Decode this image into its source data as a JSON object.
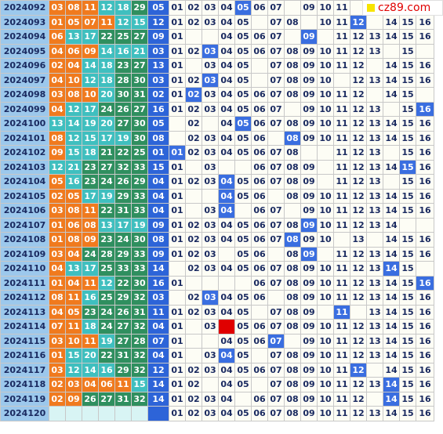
{
  "logo_text": "cz89.com",
  "rows": [
    {
      "period": "2024092",
      "balls": [
        "03",
        "08",
        "11",
        "12",
        "18",
        "29"
      ],
      "styles": [
        "r",
        "r",
        "r",
        "t",
        "t",
        "g"
      ],
      "blue": "05",
      "grid": [
        "01",
        "02",
        "03",
        "04",
        "05",
        "06",
        "07",
        "",
        "09",
        "10",
        "11",
        "",
        "",
        "",
        "",
        ""
      ],
      "hits": [
        5
      ],
      "redhit": []
    },
    {
      "period": "2024093",
      "balls": [
        "01",
        "05",
        "07",
        "11",
        "12",
        "15"
      ],
      "styles": [
        "r",
        "r",
        "r",
        "r",
        "t",
        "t"
      ],
      "blue": "12",
      "grid": [
        "01",
        "02",
        "03",
        "04",
        "05",
        "",
        "07",
        "08",
        "",
        "10",
        "11",
        "12",
        "",
        "14",
        "15",
        "16"
      ],
      "hits": [
        12
      ],
      "redhit": []
    },
    {
      "period": "2024094",
      "balls": [
        "06",
        "13",
        "17",
        "22",
        "25",
        "27"
      ],
      "styles": [
        "r",
        "t",
        "t",
        "g",
        "g",
        "g"
      ],
      "blue": "09",
      "grid": [
        "01",
        "",
        "",
        "04",
        "05",
        "06",
        "07",
        "",
        "09",
        "",
        "11",
        "12",
        "13",
        "14",
        "15",
        "16"
      ],
      "hits": [
        9
      ],
      "redhit": []
    },
    {
      "period": "2024095",
      "balls": [
        "04",
        "06",
        "09",
        "14",
        "16",
        "21"
      ],
      "styles": [
        "r",
        "r",
        "r",
        "t",
        "t",
        "t"
      ],
      "blue": "03",
      "grid": [
        "01",
        "02",
        "03",
        "04",
        "05",
        "06",
        "07",
        "08",
        "09",
        "10",
        "11",
        "12",
        "13",
        "",
        "15",
        ""
      ],
      "hits": [
        3
      ],
      "redhit": []
    },
    {
      "period": "2024096",
      "balls": [
        "02",
        "04",
        "14",
        "18",
        "23",
        "27"
      ],
      "styles": [
        "r",
        "r",
        "t",
        "t",
        "g",
        "g"
      ],
      "blue": "13",
      "grid": [
        "01",
        "",
        "03",
        "04",
        "05",
        "",
        "07",
        "08",
        "09",
        "10",
        "11",
        "12",
        "",
        "14",
        "15",
        "16"
      ],
      "hits": [],
      "redhit": []
    },
    {
      "period": "2024097",
      "balls": [
        "04",
        "10",
        "12",
        "18",
        "28",
        "30"
      ],
      "styles": [
        "r",
        "r",
        "t",
        "t",
        "g",
        "g"
      ],
      "blue": "03",
      "grid": [
        "01",
        "02",
        "03",
        "04",
        "05",
        "",
        "07",
        "08",
        "09",
        "10",
        "",
        "12",
        "13",
        "14",
        "15",
        "16"
      ],
      "hits": [
        3
      ],
      "redhit": []
    },
    {
      "period": "2024098",
      "balls": [
        "03",
        "08",
        "10",
        "20",
        "30",
        "31"
      ],
      "styles": [
        "r",
        "r",
        "r",
        "t",
        "g",
        "g"
      ],
      "blue": "02",
      "grid": [
        "01",
        "02",
        "03",
        "04",
        "05",
        "06",
        "07",
        "08",
        "09",
        "10",
        "11",
        "12",
        "",
        "14",
        "15",
        ""
      ],
      "hits": [
        2
      ],
      "redhit": []
    },
    {
      "period": "2024099",
      "balls": [
        "04",
        "12",
        "17",
        "24",
        "26",
        "27"
      ],
      "styles": [
        "r",
        "t",
        "t",
        "g",
        "g",
        "g"
      ],
      "blue": "16",
      "grid": [
        "01",
        "02",
        "03",
        "04",
        "05",
        "06",
        "07",
        "",
        "09",
        "10",
        "11",
        "12",
        "13",
        "",
        "15",
        "16"
      ],
      "hits": [
        16
      ],
      "redhit": []
    },
    {
      "period": "2024100",
      "balls": [
        "13",
        "14",
        "19",
        "20",
        "27",
        "30"
      ],
      "styles": [
        "t",
        "t",
        "t",
        "t",
        "g",
        "g"
      ],
      "blue": "05",
      "grid": [
        "",
        "02",
        "",
        "04",
        "05",
        "06",
        "07",
        "08",
        "09",
        "10",
        "11",
        "12",
        "13",
        "14",
        "15",
        "16"
      ],
      "hits": [
        5
      ],
      "redhit": []
    },
    {
      "period": "2024101",
      "balls": [
        "08",
        "12",
        "15",
        "17",
        "19",
        "30"
      ],
      "styles": [
        "r",
        "t",
        "t",
        "t",
        "t",
        "g"
      ],
      "blue": "08",
      "grid": [
        "",
        "02",
        "03",
        "04",
        "05",
        "06",
        "",
        "08",
        "09",
        "10",
        "11",
        "12",
        "13",
        "14",
        "15",
        "16"
      ],
      "hits": [
        8
      ],
      "redhit": []
    },
    {
      "period": "2024102",
      "balls": [
        "09",
        "15",
        "18",
        "21",
        "22",
        "25"
      ],
      "styles": [
        "r",
        "t",
        "t",
        "g",
        "g",
        "g"
      ],
      "blue": "01",
      "grid": [
        "01",
        "02",
        "03",
        "04",
        "05",
        "06",
        "07",
        "08",
        "",
        "",
        "11",
        "12",
        "13",
        "",
        "15",
        "16"
      ],
      "hits": [
        1
      ],
      "redhit": []
    },
    {
      "period": "2024103",
      "balls": [
        "12",
        "21",
        "23",
        "27",
        "32",
        "33"
      ],
      "styles": [
        "t",
        "t",
        "g",
        "g",
        "g",
        "g"
      ],
      "blue": "15",
      "grid": [
        "01",
        "",
        "03",
        "",
        "",
        "06",
        "07",
        "08",
        "09",
        "",
        "11",
        "12",
        "13",
        "14",
        "15",
        "16"
      ],
      "hits": [
        15
      ],
      "redhit": []
    },
    {
      "period": "2024104",
      "balls": [
        "05",
        "16",
        "23",
        "24",
        "26",
        "29"
      ],
      "styles": [
        "r",
        "t",
        "g",
        "g",
        "g",
        "g"
      ],
      "blue": "04",
      "grid": [
        "01",
        "02",
        "03",
        "04",
        "05",
        "06",
        "07",
        "08",
        "09",
        "",
        "11",
        "12",
        "13",
        "",
        "15",
        "16"
      ],
      "hits": [
        4
      ],
      "redhit": []
    },
    {
      "period": "2024105",
      "balls": [
        "02",
        "05",
        "17",
        "19",
        "29",
        "33"
      ],
      "styles": [
        "r",
        "r",
        "t",
        "t",
        "g",
        "g"
      ],
      "blue": "04",
      "grid": [
        "01",
        "",
        "",
        "04",
        "05",
        "06",
        "",
        "08",
        "09",
        "10",
        "11",
        "12",
        "13",
        "14",
        "15",
        "16"
      ],
      "hits": [
        4
      ],
      "redhit": []
    },
    {
      "period": "2024106",
      "balls": [
        "03",
        "08",
        "11",
        "22",
        "31",
        "33"
      ],
      "styles": [
        "r",
        "r",
        "r",
        "g",
        "g",
        "g"
      ],
      "blue": "04",
      "grid": [
        "01",
        "",
        "03",
        "04",
        "",
        "06",
        "07",
        "",
        "09",
        "10",
        "11",
        "12",
        "13",
        "14",
        "15",
        "16"
      ],
      "hits": [
        4
      ],
      "redhit": []
    },
    {
      "period": "2024107",
      "balls": [
        "01",
        "06",
        "08",
        "13",
        "17",
        "19"
      ],
      "styles": [
        "r",
        "r",
        "r",
        "t",
        "t",
        "t"
      ],
      "blue": "09",
      "grid": [
        "01",
        "02",
        "03",
        "04",
        "05",
        "06",
        "07",
        "08",
        "09",
        "10",
        "11",
        "12",
        "13",
        "14",
        "",
        ""
      ],
      "hits": [
        9
      ],
      "redhit": []
    },
    {
      "period": "2024108",
      "balls": [
        "01",
        "08",
        "09",
        "23",
        "24",
        "30"
      ],
      "styles": [
        "r",
        "r",
        "r",
        "g",
        "g",
        "g"
      ],
      "blue": "08",
      "grid": [
        "01",
        "02",
        "03",
        "04",
        "05",
        "06",
        "07",
        "08",
        "09",
        "10",
        "",
        "13",
        "",
        "14",
        "15",
        "16"
      ],
      "hits": [
        8
      ],
      "redhit": []
    },
    {
      "period": "2024109",
      "balls": [
        "03",
        "04",
        "24",
        "28",
        "29",
        "33"
      ],
      "styles": [
        "r",
        "r",
        "g",
        "g",
        "g",
        "g"
      ],
      "blue": "09",
      "grid": [
        "01",
        "02",
        "03",
        "",
        "05",
        "06",
        "",
        "08",
        "09",
        "",
        "11",
        "12",
        "13",
        "14",
        "15",
        "16"
      ],
      "hits": [
        9
      ],
      "redhit": []
    },
    {
      "period": "2024110",
      "balls": [
        "04",
        "13",
        "17",
        "25",
        "33",
        "33"
      ],
      "styles": [
        "r",
        "t",
        "t",
        "g",
        "g",
        "g"
      ],
      "blue": "14",
      "grid": [
        "",
        "02",
        "03",
        "04",
        "05",
        "06",
        "07",
        "08",
        "09",
        "10",
        "11",
        "12",
        "13",
        "14",
        "15",
        ""
      ],
      "hits": [
        14
      ],
      "redhit": []
    },
    {
      "period": "2024111",
      "balls": [
        "01",
        "04",
        "11",
        "12",
        "22",
        "30"
      ],
      "styles": [
        "r",
        "r",
        "r",
        "t",
        "g",
        "g"
      ],
      "blue": "16",
      "grid": [
        "01",
        "",
        "",
        "",
        "",
        "06",
        "07",
        "08",
        "09",
        "10",
        "11",
        "12",
        "13",
        "14",
        "15",
        "16"
      ],
      "hits": [
        16
      ],
      "redhit": []
    },
    {
      "period": "2024112",
      "balls": [
        "08",
        "11",
        "16",
        "25",
        "29",
        "32"
      ],
      "styles": [
        "r",
        "r",
        "t",
        "g",
        "g",
        "g"
      ],
      "blue": "03",
      "grid": [
        "",
        "02",
        "03",
        "04",
        "05",
        "06",
        "",
        "08",
        "09",
        "10",
        "11",
        "12",
        "13",
        "14",
        "15",
        "16"
      ],
      "hits": [
        3
      ],
      "redhit": []
    },
    {
      "period": "2024113",
      "balls": [
        "04",
        "05",
        "23",
        "24",
        "26",
        "31"
      ],
      "styles": [
        "r",
        "r",
        "g",
        "g",
        "g",
        "g"
      ],
      "blue": "11",
      "grid": [
        "01",
        "02",
        "03",
        "04",
        "05",
        "",
        "07",
        "08",
        "09",
        "",
        "11",
        "",
        "13",
        "14",
        "15",
        "16"
      ],
      "hits": [
        11
      ],
      "redhit": []
    },
    {
      "period": "2024114",
      "balls": [
        "07",
        "11",
        "18",
        "24",
        "27",
        "32"
      ],
      "styles": [
        "r",
        "r",
        "t",
        "g",
        "g",
        "g"
      ],
      "blue": "04",
      "grid": [
        "01",
        "",
        "03",
        "04",
        "05",
        "06",
        "07",
        "08",
        "09",
        "10",
        "11",
        "12",
        "13",
        "14",
        "15",
        "16"
      ],
      "hits": [],
      "redhit": [
        4
      ]
    },
    {
      "period": "2024115",
      "balls": [
        "03",
        "10",
        "11",
        "19",
        "27",
        "28"
      ],
      "styles": [
        "r",
        "r",
        "r",
        "t",
        "g",
        "g"
      ],
      "blue": "07",
      "grid": [
        "01",
        "",
        "",
        "04",
        "05",
        "06",
        "07",
        "",
        "09",
        "10",
        "11",
        "12",
        "13",
        "14",
        "15",
        "16"
      ],
      "hits": [
        7
      ],
      "redhit": []
    },
    {
      "period": "2024116",
      "balls": [
        "01",
        "15",
        "20",
        "22",
        "31",
        "32"
      ],
      "styles": [
        "r",
        "t",
        "t",
        "g",
        "g",
        "g"
      ],
      "blue": "04",
      "grid": [
        "01",
        "",
        "03",
        "04",
        "05",
        "",
        "07",
        "08",
        "09",
        "10",
        "11",
        "12",
        "13",
        "14",
        "15",
        "16"
      ],
      "hits": [
        4
      ],
      "redhit": []
    },
    {
      "period": "2024117",
      "balls": [
        "03",
        "12",
        "14",
        "16",
        "29",
        "32"
      ],
      "styles": [
        "r",
        "t",
        "t",
        "t",
        "g",
        "g"
      ],
      "blue": "12",
      "grid": [
        "01",
        "02",
        "03",
        "04",
        "05",
        "06",
        "07",
        "08",
        "09",
        "10",
        "11",
        "12",
        "",
        "14",
        "15",
        "16"
      ],
      "hits": [
        12
      ],
      "redhit": []
    },
    {
      "period": "2024118",
      "balls": [
        "02",
        "03",
        "04",
        "06",
        "11",
        "15"
      ],
      "styles": [
        "r",
        "r",
        "r",
        "r",
        "r",
        "t"
      ],
      "blue": "14",
      "grid": [
        "01",
        "02",
        "",
        "04",
        "05",
        "",
        "07",
        "08",
        "09",
        "10",
        "11",
        "12",
        "13",
        "14",
        "15",
        "16"
      ],
      "hits": [
        14
      ],
      "redhit": []
    },
    {
      "period": "2024119",
      "balls": [
        "02",
        "09",
        "26",
        "27",
        "31",
        "32"
      ],
      "styles": [
        "r",
        "r",
        "g",
        "g",
        "g",
        "g"
      ],
      "blue": "14",
      "grid": [
        "01",
        "02",
        "03",
        "04",
        "",
        "06",
        "07",
        "08",
        "09",
        "10",
        "11",
        "12",
        "",
        "14",
        "15",
        "16"
      ],
      "hits": [
        14
      ],
      "redhit": []
    }
  ],
  "last_row": {
    "period": "2024120",
    "grid": [
      "01",
      "02",
      "03",
      "04",
      "05",
      "06",
      "07",
      "08",
      "09",
      "10",
      "11",
      "12",
      "13",
      "14",
      "15",
      "16"
    ]
  }
}
